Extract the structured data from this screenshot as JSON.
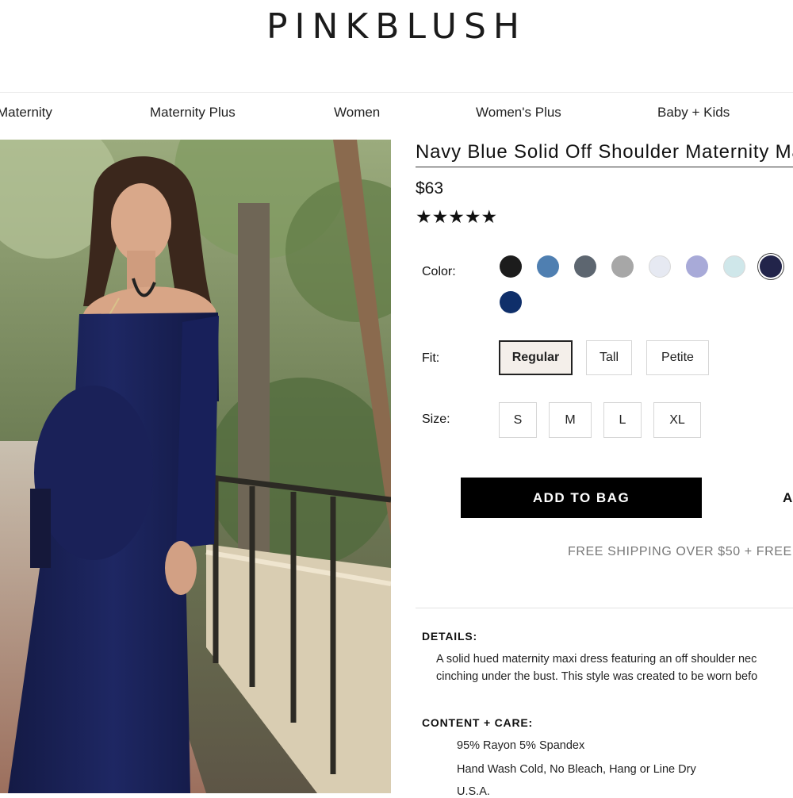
{
  "brand": {
    "logo": "PINKBLUSH"
  },
  "nav": {
    "items": [
      "Maternity",
      "Maternity Plus",
      "Women",
      "Women's Plus",
      "Baby + Kids"
    ]
  },
  "product": {
    "title": "Navy Blue Solid Off Shoulder Maternity Maxi Dress",
    "price": "$63",
    "rating_stars": "★★★★★",
    "rating": 5,
    "color_label": "Color:",
    "colors": [
      "#1c1c1c",
      "#4f7fb1",
      "#5d6670",
      "#a7a7a7",
      "#e6e9f2",
      "#a8aad8",
      "#cfe7ea",
      "#22244a",
      "#0f2f6a"
    ],
    "selected_color_index": 7,
    "fit_label": "Fit:",
    "fit_options": [
      "Regular",
      "Tall",
      "Petite"
    ],
    "selected_fit": "Regular",
    "size_label": "Size:",
    "size_options": [
      "S",
      "M",
      "L",
      "XL"
    ],
    "add_to_bag": "ADD TO BAG",
    "add_to_bag_secondary": "A",
    "shipping_text": "FREE SHIPPING OVER $50 + FREE"
  },
  "details": {
    "heading": "DETAILS:",
    "line1": "A solid hued maternity maxi dress featuring an off shoulder nec",
    "line2": "cinching under the bust. This style was created to be worn befo"
  },
  "care": {
    "heading": "CONTENT + CARE:",
    "lines": [
      "95% Rayon 5% Spandex",
      "Hand Wash Cold, No Bleach, Hang or Line Dry",
      "U.S.A."
    ]
  }
}
